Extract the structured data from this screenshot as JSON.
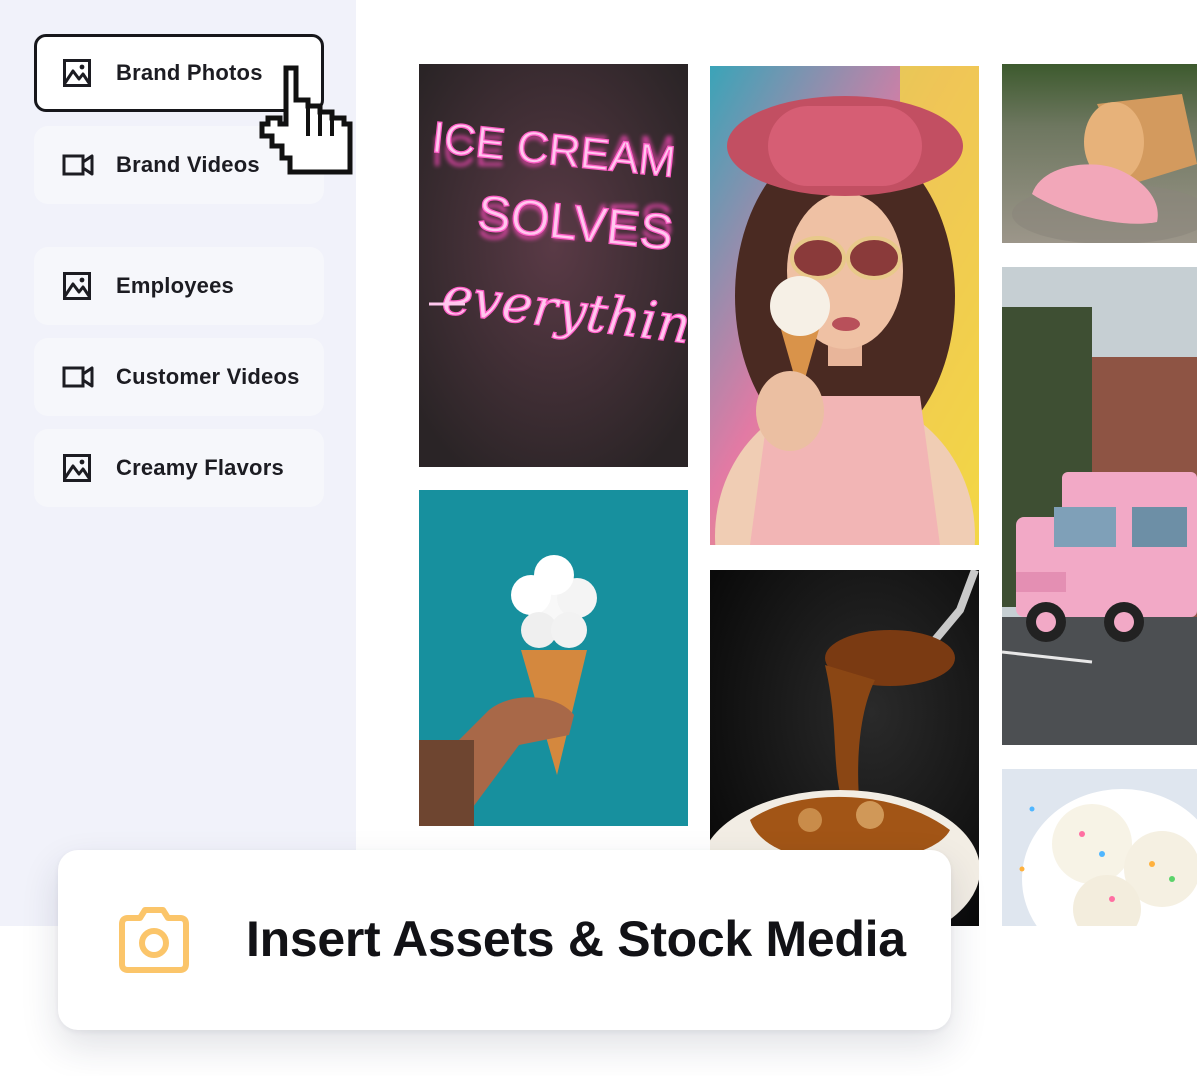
{
  "sidebar": {
    "items": [
      {
        "label": "Brand Photos",
        "icon": "image-icon",
        "active": true
      },
      {
        "label": "Brand Videos",
        "icon": "video-icon",
        "active": false
      },
      {
        "label": "Employees",
        "icon": "image-icon",
        "active": false
      },
      {
        "label": "Customer Videos",
        "icon": "video-icon",
        "active": false
      },
      {
        "label": "Creamy Flavors",
        "icon": "image-icon",
        "active": false
      }
    ]
  },
  "gallery": {
    "neon_sign": {
      "lines": [
        "ICE CREAM",
        "SOLVES",
        "everything"
      ]
    }
  },
  "banner": {
    "icon": "camera-icon",
    "title": "Insert Assets & Stock Media"
  },
  "colors": {
    "accent_icon": "#fbc56a",
    "neon_pink": "#ff5fc8",
    "sidebar_bg": "#f1f2fa"
  }
}
